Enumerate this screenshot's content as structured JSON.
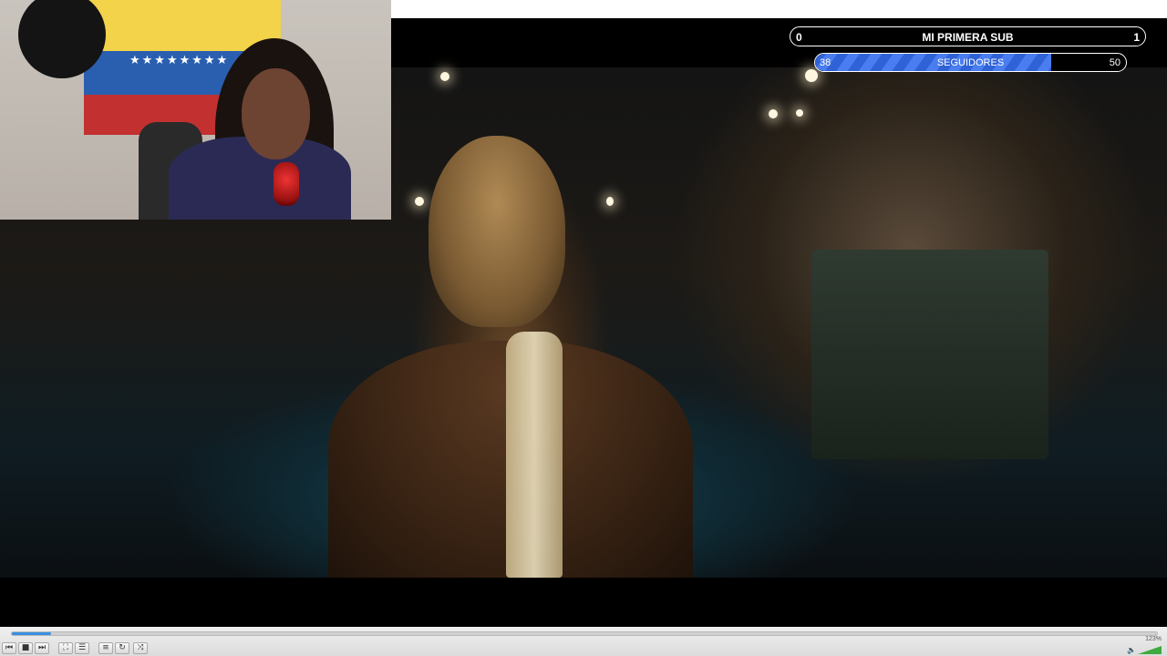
{
  "overlay": {
    "sub_goal": {
      "left": "0",
      "title": "MI PRIMERA SUB",
      "right": "1"
    },
    "followers_goal": {
      "current": "38",
      "label": "SEGUIDORES",
      "target": "50",
      "progress": 0.76
    }
  },
  "player": {
    "seek_progress": 0.034,
    "volume_label": "123%",
    "buttons": [
      {
        "name": "previous-button",
        "icon": "⏮"
      },
      {
        "name": "stop-button",
        "icon": "■"
      },
      {
        "name": "next-button",
        "icon": "⏭"
      },
      {
        "name": "fullscreen-button",
        "icon": "⛶"
      },
      {
        "name": "extended-settings-button",
        "icon": "☰"
      },
      {
        "name": "playlist-button",
        "icon": "≡"
      },
      {
        "name": "loop-button",
        "icon": "↻"
      },
      {
        "name": "shuffle-button",
        "icon": "⤨"
      }
    ]
  }
}
